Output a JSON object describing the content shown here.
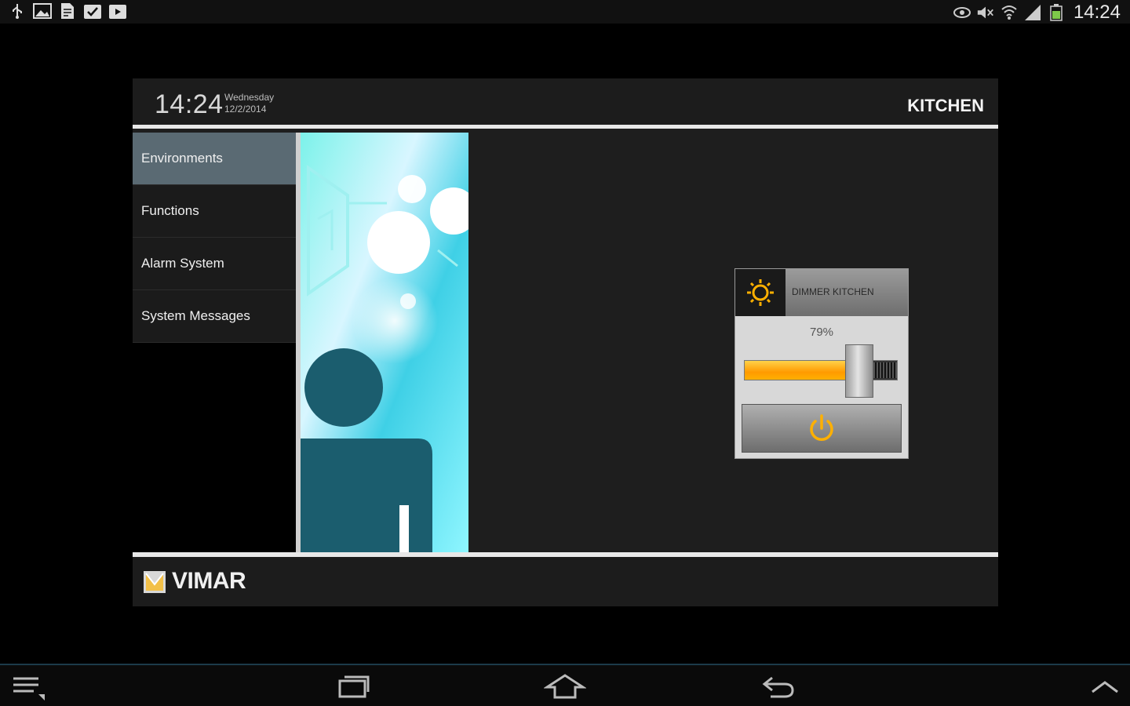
{
  "status_bar": {
    "time": "14:24",
    "left_icons": [
      "usb-icon",
      "gallery-icon",
      "document-icon",
      "task-icon",
      "media-icon"
    ],
    "right_icons": [
      "eye-icon",
      "mute-icon",
      "wifi-icon",
      "signal-icon",
      "battery-icon"
    ]
  },
  "header": {
    "time": "14:24",
    "day": "Wednesday",
    "date": "12/2/2014",
    "room": "KITCHEN"
  },
  "sidebar": {
    "items": [
      {
        "label": "Environments",
        "active": true
      },
      {
        "label": "Functions",
        "active": false
      },
      {
        "label": "Alarm System",
        "active": false
      },
      {
        "label": "System Messages",
        "active": false
      }
    ]
  },
  "dimmer": {
    "label": "DIMMER KITCHEN",
    "percent_text": "79%",
    "level": 0.79,
    "accent": "#ffb000"
  },
  "footer": {
    "brand": "VIMAR"
  },
  "nav_bar": {
    "buttons": [
      "menu-icon",
      "recent-apps-icon",
      "home-icon",
      "back-icon",
      "expand-icon"
    ]
  }
}
